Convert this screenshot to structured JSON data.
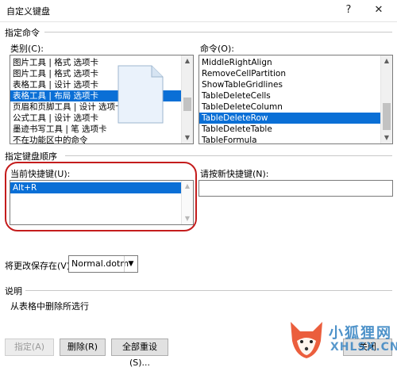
{
  "window": {
    "title": "自定义键盘",
    "help_btn": "?",
    "close_btn": "✕"
  },
  "specify_command": {
    "group_label": "指定命令",
    "categories_label": "类别(C):",
    "categories": [
      "图片工具 | 格式 选项卡",
      "图片工具 | 格式 选项卡",
      "表格工具 | 设计 选项卡",
      "表格工具 | 布局 选项卡",
      "页眉和页脚工具 | 设计 选项卡",
      "公式工具 | 设计 选项卡",
      "墨迹书写工具 | 笔 选项卡",
      "不在功能区中的命令"
    ],
    "categories_selected_index": 3,
    "commands_label": "命令(O):",
    "commands": [
      "MiddleRightAlign",
      "RemoveCellPartition",
      "ShowTableGridlines",
      "TableDeleteCells",
      "TableDeleteColumn",
      "TableDeleteRow",
      "TableDeleteTable",
      "TableFormula"
    ],
    "commands_selected_index": 5
  },
  "keyboard_sequence": {
    "group_label": "指定键盘顺序",
    "current_keys_label": "当前快捷键(U):",
    "current_keys": [
      "Alt+R"
    ],
    "new_key_label": "请按新快捷键(N):",
    "new_key_value": ""
  },
  "save_in": {
    "label": "将更改保存在(V):",
    "value": "Normal.dotm"
  },
  "description": {
    "group_label": "说明",
    "text": "从表格中删除所选行"
  },
  "buttons": {
    "assign": "指定(A)",
    "remove": "删除(R)",
    "reset_all": "全部重设(S)...",
    "close": "关闭"
  },
  "watermark": {
    "cn": "小狐狸网",
    "en": "XHLSX.CN"
  },
  "colors": {
    "selection": "#0a6fd6",
    "annotation": "#c41c1c",
    "watermark": "#2f7fc0"
  }
}
